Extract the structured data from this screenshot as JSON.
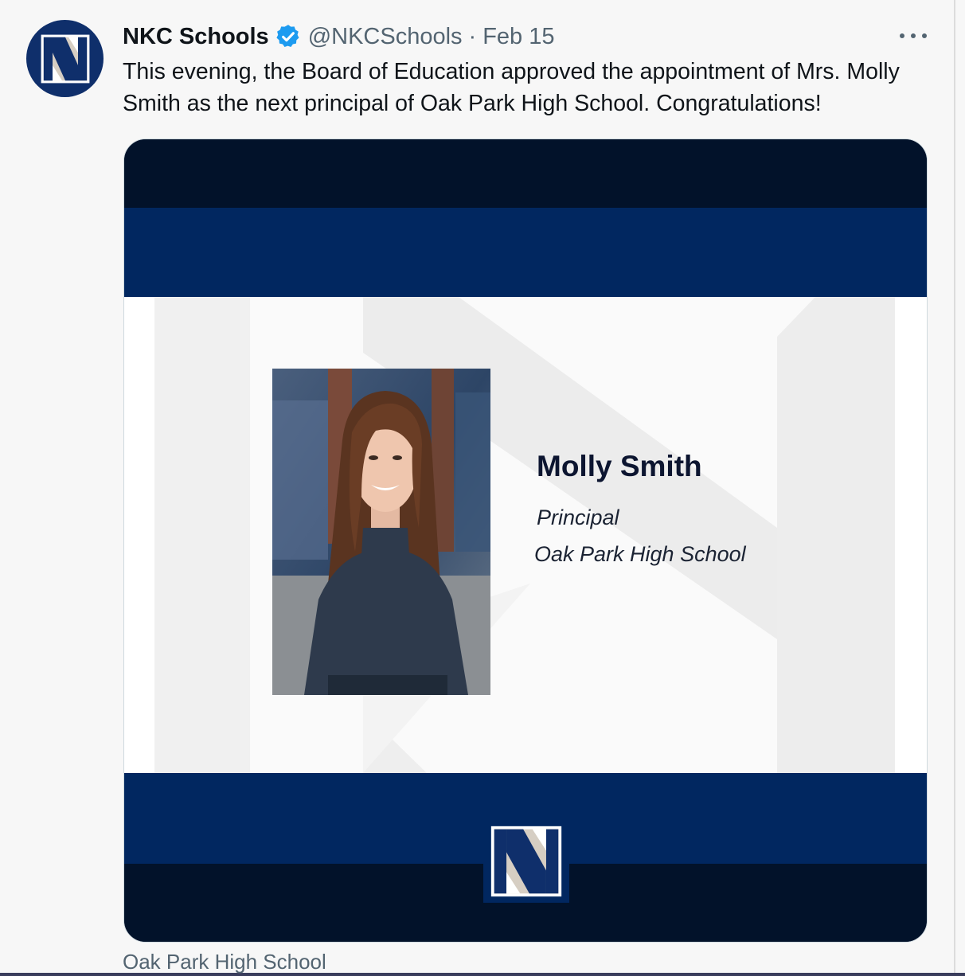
{
  "tweet": {
    "display_name": "NKC Schools",
    "verified_icon": "verified-badge-icon",
    "handle": "@NKCSchools",
    "separator": "·",
    "date": "Feb 15",
    "more_icon": "more-options-icon",
    "text": "This evening, the Board of Education approved the appointment of Mrs. Molly Smith as the next principal of Oak Park High School. Congratulations!"
  },
  "media": {
    "name": "Molly Smith",
    "role": "Principal",
    "school": "Oak Park High School"
  },
  "caption": "Oak Park High School",
  "colors": {
    "brand_navy": "#012760",
    "brand_dark": "#02122a",
    "verified_blue": "#1d9bf0",
    "muted_text": "#536471"
  }
}
